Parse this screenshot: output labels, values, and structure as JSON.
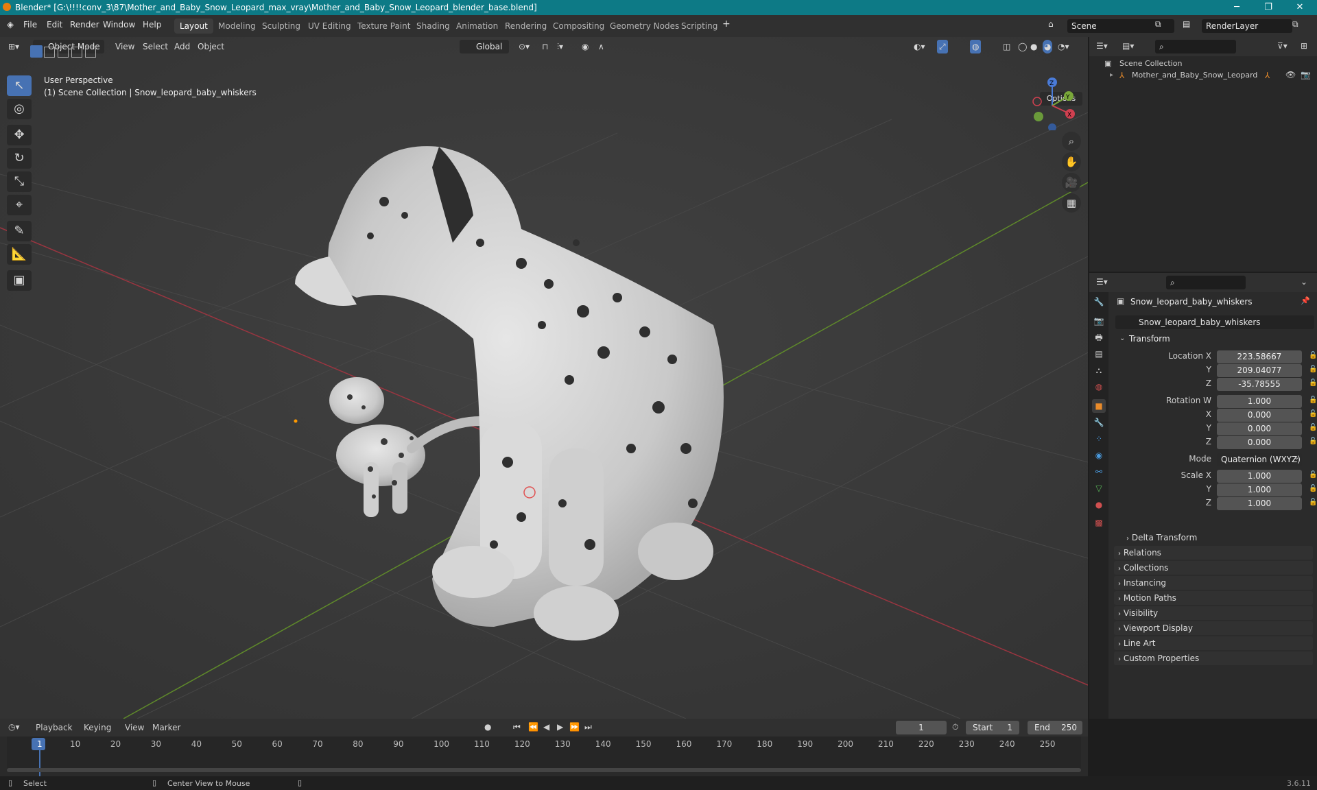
{
  "titlebar": {
    "title": "Blender* [G:\\!!!!conv_3\\87\\Mother_and_Baby_Snow_Leopard_max_vray\\Mother_and_Baby_Snow_Leopard_blender_base.blend]",
    "minimize": "─",
    "maximize": "❐",
    "close": "✕"
  },
  "menu": {
    "file": "File",
    "edit": "Edit",
    "render": "Render",
    "window": "Window",
    "help": "Help"
  },
  "workspaces": [
    "Layout",
    "Modeling",
    "Sculpting",
    "UV Editing",
    "Texture Paint",
    "Shading",
    "Animation",
    "Rendering",
    "Compositing",
    "Geometry Nodes",
    "Scripting"
  ],
  "scene": {
    "label": "Scene",
    "render_layer": "RenderLayer"
  },
  "viewport": {
    "mode": "Object Mode",
    "view": "View",
    "select": "Select",
    "add": "Add",
    "object": "Object",
    "orientation": "Global",
    "options": "Options",
    "perspective": "User Perspective",
    "collection_info": "(1) Scene Collection | Snow_leopard_baby_whiskers",
    "gizmo": {
      "x": "X",
      "y": "Y",
      "z": "Z"
    }
  },
  "outliner": {
    "scene_collection": "Scene Collection",
    "item": "Mother_and_Baby_Snow_Leopard"
  },
  "properties": {
    "object_name": "Snow_leopard_baby_whiskers",
    "data_name": "Snow_leopard_baby_whiskers",
    "transform": "Transform",
    "location_x_label": "Location X",
    "location_x": "223.58667",
    "y_label": "Y",
    "location_y": "209.04077",
    "z_label": "Z",
    "location_z": "-35.78555",
    "rotation_w_label": "Rotation W",
    "rotation_w": "1.000",
    "x_label": "X",
    "rotation_x": "0.000",
    "rotation_y": "0.000",
    "rotation_z": "0.000",
    "mode_label": "Mode",
    "mode": "Quaternion (WXYZ)",
    "scale_x_label": "Scale X",
    "scale_x": "1.000",
    "scale_y": "1.000",
    "scale_z": "1.000",
    "delta_transform": "Delta Transform",
    "panels": [
      "Relations",
      "Collections",
      "Instancing",
      "Motion Paths",
      "Visibility",
      "Viewport Display",
      "Line Art",
      "Custom Properties"
    ]
  },
  "timeline": {
    "playback": "Playback",
    "keying": "Keying",
    "view": "View",
    "marker": "Marker",
    "current_frame": "1",
    "start_label": "Start",
    "start": "1",
    "end_label": "End",
    "end": "250",
    "ticks": [
      "1",
      "10",
      "20",
      "30",
      "40",
      "50",
      "60",
      "70",
      "80",
      "90",
      "100",
      "110",
      "120",
      "130",
      "140",
      "150",
      "160",
      "170",
      "180",
      "190",
      "200",
      "210",
      "220",
      "230",
      "240",
      "250"
    ]
  },
  "statusbar": {
    "select": "Select",
    "center_view": "Center View to Mouse",
    "version": "3.6.11"
  }
}
